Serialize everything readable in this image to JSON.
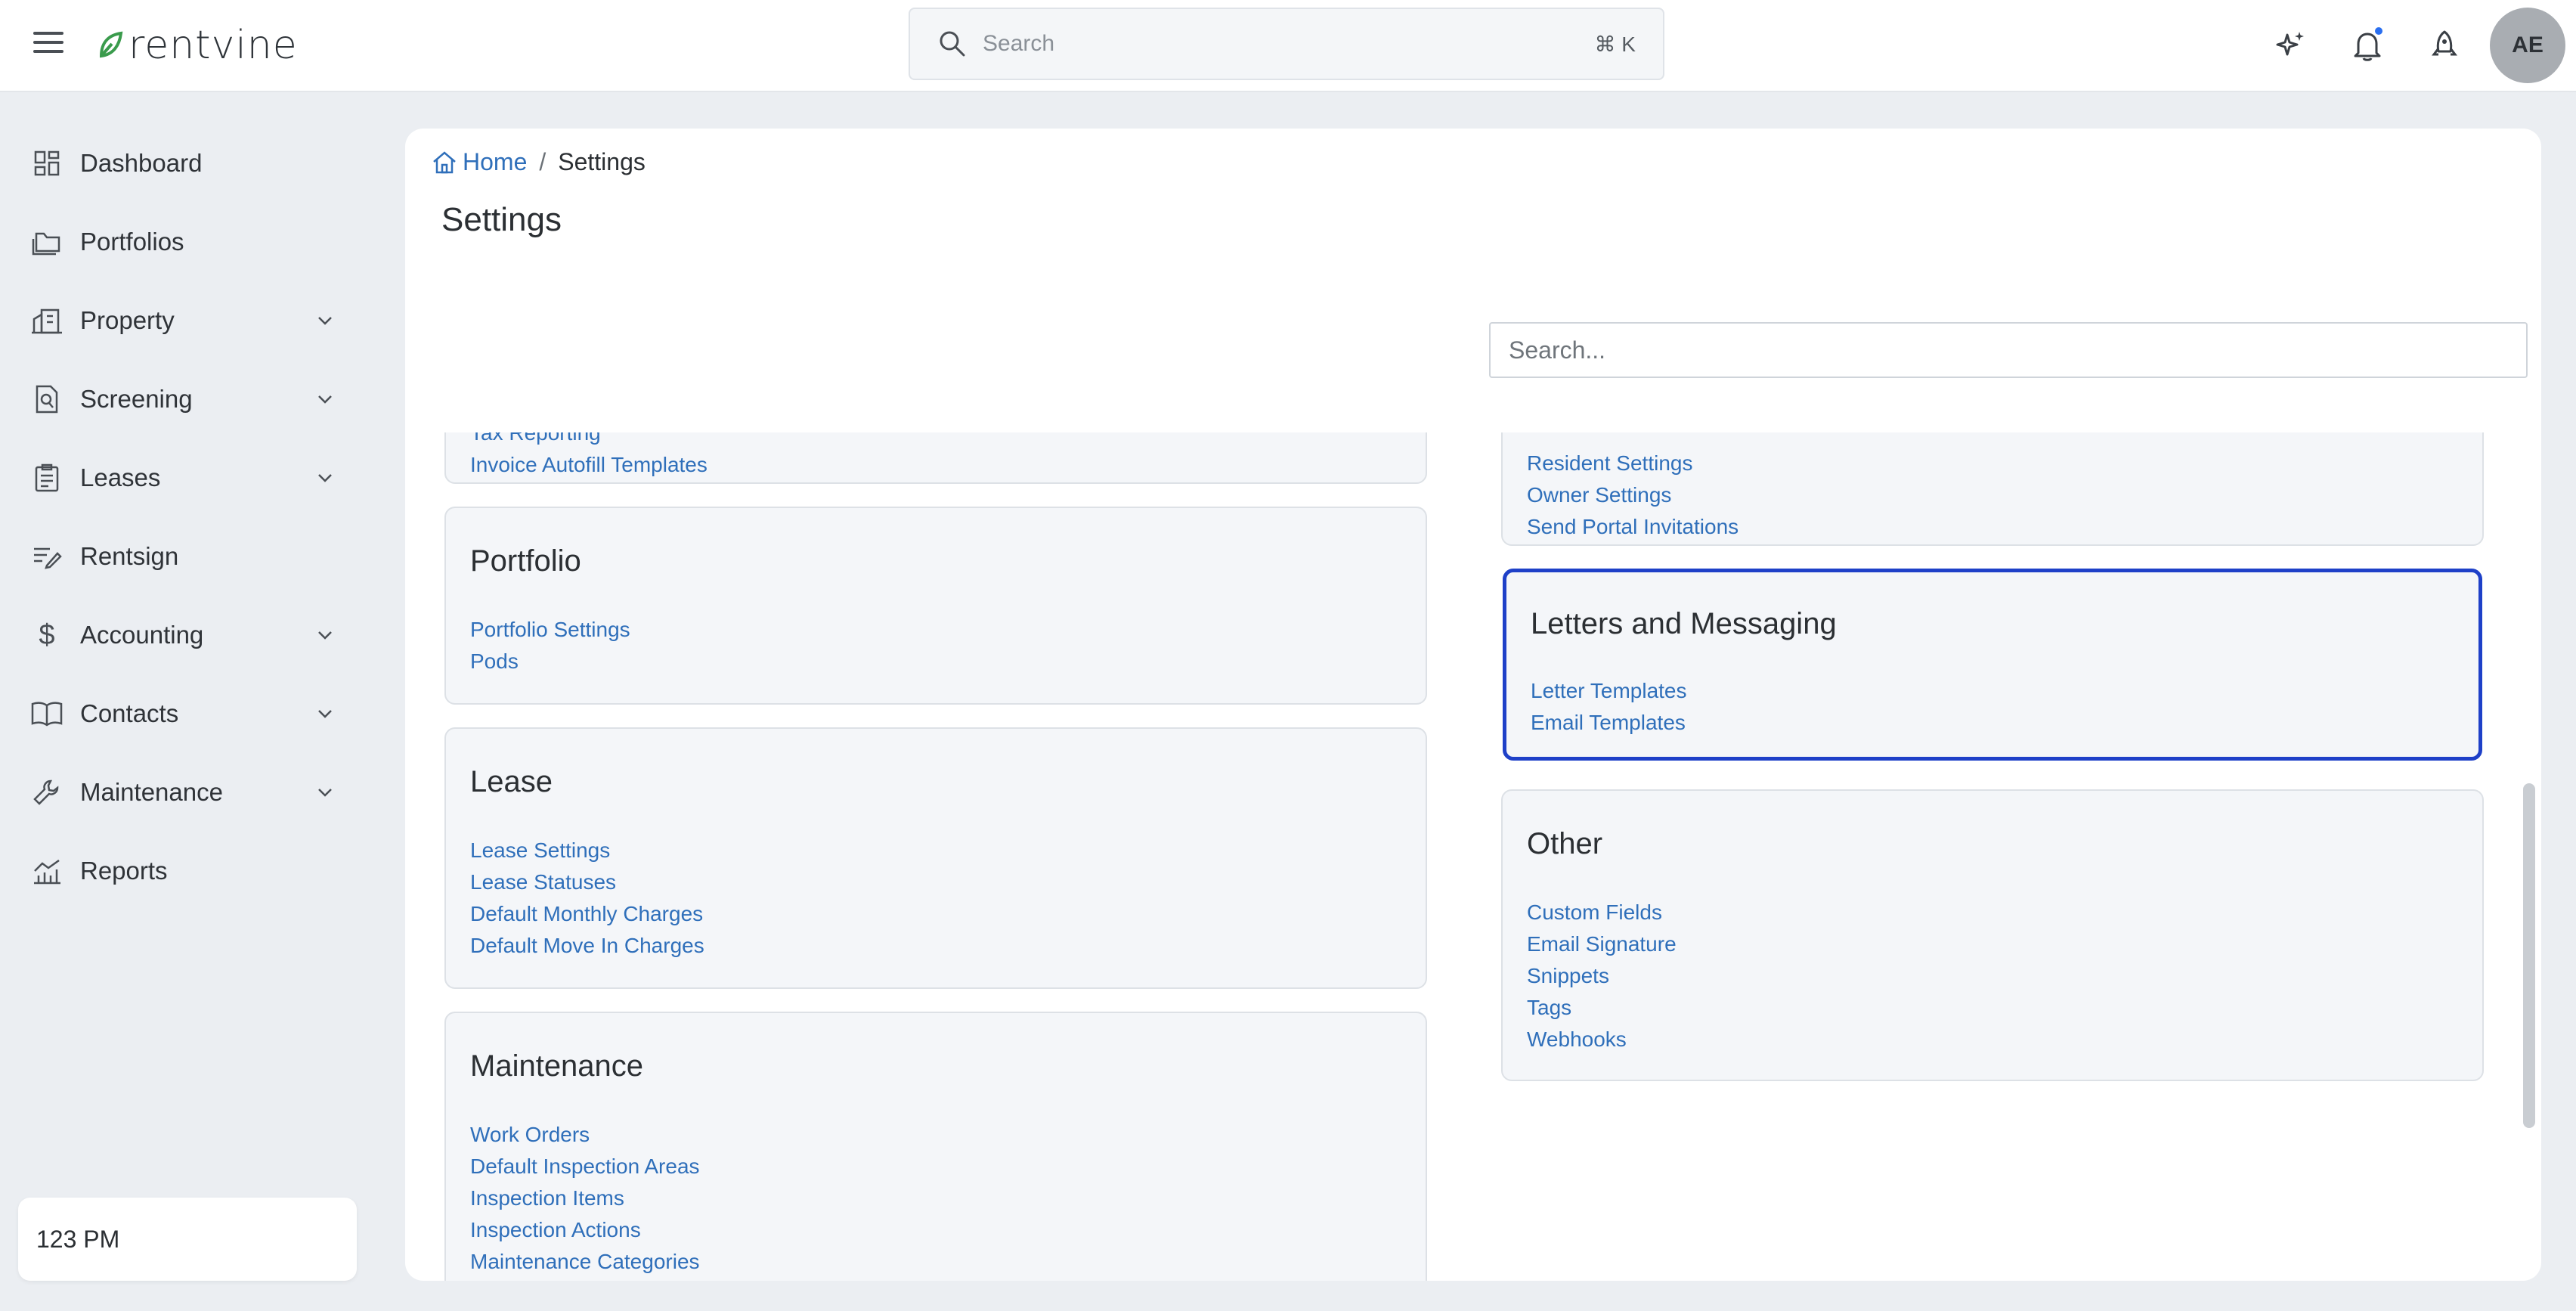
{
  "brand": {
    "name": "rentvine"
  },
  "search": {
    "placeholder": "Search",
    "shortcut": "⌘ K"
  },
  "user": {
    "initials": "AE"
  },
  "icons": {
    "menu": "hamburger-icon",
    "search": "search-icon",
    "sparkle": "sparkle-icon",
    "bell": "bell-icon",
    "rocket": "rocket-icon"
  },
  "colors": {
    "accent": "#2f6fba",
    "selected_border": "#1e40c8",
    "notification": "#2a6ff0"
  },
  "sidebar": {
    "items": [
      {
        "label": "Dashboard",
        "icon": "dashboard-icon",
        "expandable": false
      },
      {
        "label": "Portfolios",
        "icon": "folder-icon",
        "expandable": false
      },
      {
        "label": "Property",
        "icon": "building-icon",
        "expandable": true
      },
      {
        "label": "Screening",
        "icon": "screening-icon",
        "expandable": true
      },
      {
        "label": "Leases",
        "icon": "clipboard-icon",
        "expandable": true
      },
      {
        "label": "Rentsign",
        "icon": "signature-icon",
        "expandable": false
      },
      {
        "label": "Accounting",
        "icon": "dollar-icon",
        "expandable": true
      },
      {
        "label": "Contacts",
        "icon": "book-icon",
        "expandable": true
      },
      {
        "label": "Maintenance",
        "icon": "wrench-icon",
        "expandable": true
      },
      {
        "label": "Reports",
        "icon": "chart-icon",
        "expandable": false
      }
    ],
    "time": "123 PM"
  },
  "main": {
    "breadcrumb": {
      "home": "Home",
      "separator": "/",
      "current": "Settings"
    },
    "title": "Settings",
    "search_placeholder": "Search...",
    "left_cards": [
      {
        "title": "",
        "links": [
          "Tax Reporting",
          "Invoice Autofill Templates"
        ]
      },
      {
        "title": "Portfolio",
        "links": [
          "Portfolio Settings",
          "Pods"
        ]
      },
      {
        "title": "Lease",
        "links": [
          "Lease Settings",
          "Lease Statuses",
          "Default Monthly Charges",
          "Default Move In Charges"
        ]
      },
      {
        "title": "Maintenance",
        "links": [
          "Work Orders",
          "Default Inspection Areas",
          "Inspection Items",
          "Inspection Actions",
          "Maintenance Categories"
        ]
      }
    ],
    "right_cards": [
      {
        "title": "",
        "links": [
          "Resident Settings",
          "Owner Settings",
          "Send Portal Invitations"
        ]
      },
      {
        "title": "Letters and Messaging",
        "links": [
          "Letter Templates",
          "Email Templates"
        ],
        "selected": true
      },
      {
        "title": "Other",
        "links": [
          "Custom Fields",
          "Email Signature",
          "Snippets",
          "Tags",
          "Webhooks"
        ]
      }
    ]
  }
}
